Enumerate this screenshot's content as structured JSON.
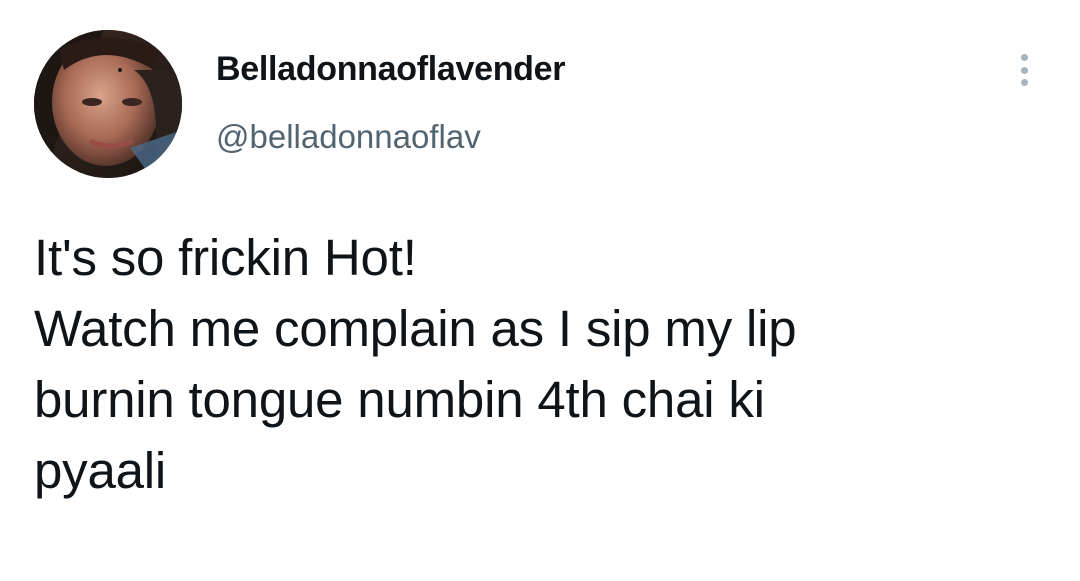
{
  "tweet": {
    "author": {
      "display_name": "Belladonnaoflavender",
      "handle": "@belladonnaoflav",
      "avatar_icon": "profile-photo"
    },
    "menu_icon": "more-vertical-icon",
    "text_lines": [
      "It's so frickin Hot!",
      "Watch me complain as I sip my lip",
      "burnin tongue numbin 4th chai ki",
      "pyaali"
    ]
  },
  "colors": {
    "text": "#0f1419",
    "secondary_text": "#536471",
    "menu_dots": "#a9b3bb",
    "background": "#ffffff"
  }
}
